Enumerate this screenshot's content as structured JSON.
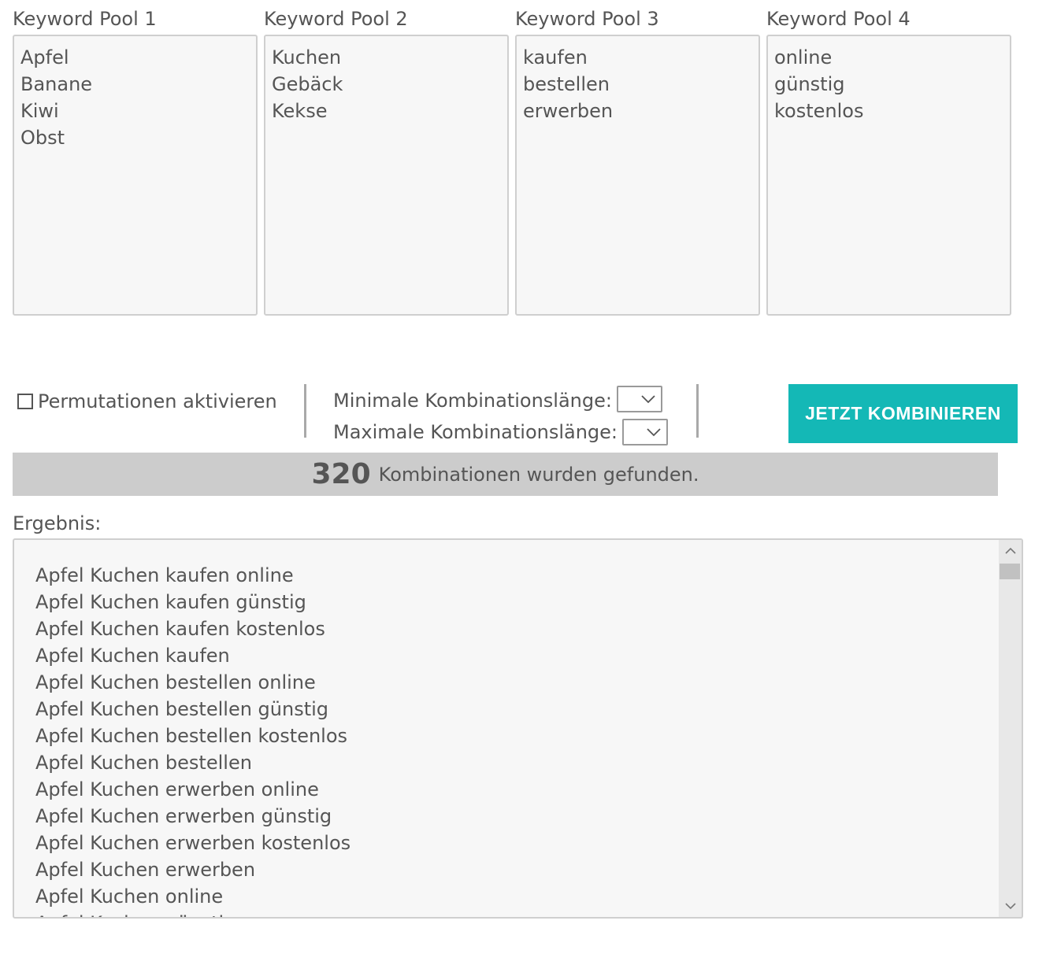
{
  "pools": [
    {
      "label": "Keyword Pool 1",
      "items": [
        "Apfel",
        "Banane",
        "Kiwi",
        "Obst"
      ]
    },
    {
      "label": "Keyword Pool 2",
      "items": [
        "Kuchen",
        "Gebäck",
        "Kekse"
      ]
    },
    {
      "label": "Keyword Pool 3",
      "items": [
        "kaufen",
        "bestellen",
        "erwerben"
      ]
    },
    {
      "label": "Keyword Pool 4",
      "items": [
        "online",
        "günstig",
        "kostenlos"
      ]
    }
  ],
  "options": {
    "permutations_label": "Permutationen aktivieren",
    "permutations_checked": false,
    "min_length_label": "Minimale Kombinationslänge:",
    "max_length_label": "Maximale Kombinationslänge:",
    "min_length_value": "",
    "max_length_value": ""
  },
  "combine_button": "JETZT KOMBINIEREN",
  "summary": {
    "count": "320",
    "text": "Kombinationen wurden gefunden."
  },
  "result": {
    "label": "Ergebnis:",
    "lines": [
      "Apfel Kuchen kaufen online",
      "Apfel Kuchen kaufen günstig",
      "Apfel Kuchen kaufen kostenlos",
      "Apfel Kuchen kaufen",
      "Apfel Kuchen bestellen online",
      "Apfel Kuchen bestellen günstig",
      "Apfel Kuchen bestellen kostenlos",
      "Apfel Kuchen bestellen",
      "Apfel Kuchen erwerben online",
      "Apfel Kuchen erwerben günstig",
      "Apfel Kuchen erwerben kostenlos",
      "Apfel Kuchen erwerben",
      "Apfel Kuchen online",
      "Apfel Kuchen günstig"
    ]
  },
  "colors": {
    "accent": "#14b8b6",
    "summary_bar": "#cccccc",
    "text": "#555555",
    "field_bg": "#f7f7f7"
  }
}
